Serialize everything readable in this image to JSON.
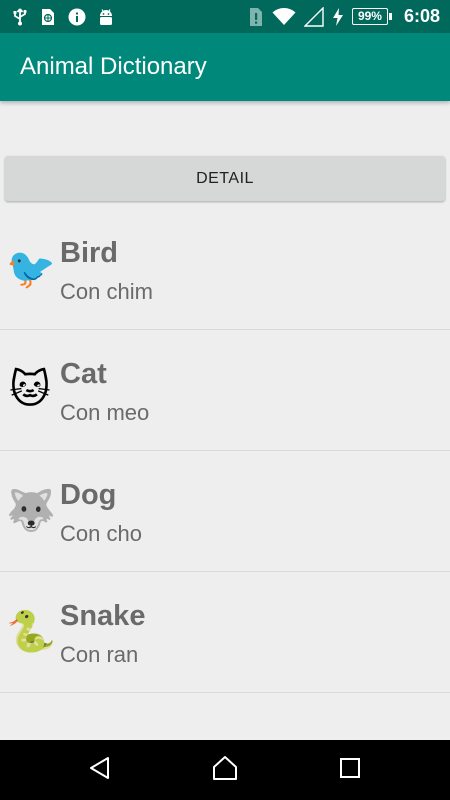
{
  "status_bar": {
    "left_icons": [
      "usb-icon",
      "sim-card-icon",
      "info-icon",
      "android-debug-icon"
    ],
    "right_icons": [
      "sim-alert-icon",
      "wifi-icon",
      "cell-signal-icon",
      "charging-icon"
    ],
    "battery": "99%",
    "time": "6:08"
  },
  "app_bar": {
    "title": "Animal Dictionary",
    "color": "#00897b",
    "status_color": "#00695c"
  },
  "detail_button": {
    "label": "DETAIL"
  },
  "animals": [
    {
      "name": "Bird",
      "translation": "Con chim",
      "emoji": "🐦"
    },
    {
      "name": "Cat",
      "translation": "Con meo",
      "emoji": "🐱"
    },
    {
      "name": "Dog",
      "translation": "Con cho",
      "emoji": "🐺"
    },
    {
      "name": "Snake",
      "translation": "Con ran",
      "emoji": "🐍"
    }
  ],
  "nav_bar": {
    "icons": [
      "back-icon",
      "home-icon",
      "recents-icon"
    ]
  }
}
